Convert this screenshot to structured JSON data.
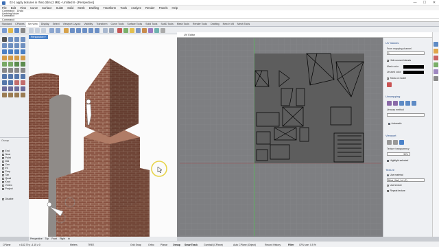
{
  "window": {
    "title": "02-1 apply textures in rhino.3dm (2 MB) - Untitled 8 - [Perspective]",
    "controls": [
      "—",
      "☐",
      "✕"
    ]
  },
  "menu": [
    "File",
    "Edit",
    "View",
    "Curve",
    "Surface",
    "SubD",
    "Solid",
    "Mesh",
    "Drafting",
    "Transform",
    "Tools",
    "Analyze",
    "Render",
    "Panels",
    "Help"
  ],
  "command_history": [
    "Command: _Undo",
    "Undoing Move",
    "Command:"
  ],
  "command_prompt": "Command:",
  "toolbar_tabs": [
    "Standard",
    "CPlanes",
    "Set View",
    "Display",
    "Select",
    "Viewport Layout",
    "Visibility",
    "Transform",
    "Curve Tools",
    "Surface Tools",
    "Solid Tools",
    "SubD Tools",
    "Mesh Tools",
    "Render Tools",
    "Drafting",
    "New in V8",
    "Mesh Tools"
  ],
  "active_tab_index": 2,
  "viewport": {
    "label": "Perspective ▾"
  },
  "viewport_tabs": [
    "Perspective",
    "Top",
    "Front",
    "Right",
    "⊕"
  ],
  "osnap": {
    "header": "Osnap",
    "items": [
      "End",
      "Near",
      "Point",
      "Mid",
      "Cen",
      "Int",
      "Perp",
      "Tan",
      "Quad",
      "Knot",
      "Vertex",
      "Project",
      "Disable"
    ]
  },
  "uv_editor": {
    "title": "UV Editor"
  },
  "panel": {
    "uv_islands": "UV Islands",
    "from_mapping_label": "From mapping channel",
    "mapping_channel": "1",
    "hide_unused": "Hide unused islands",
    "mesh_color_label": "Mesh color",
    "unused_color_label": "Unused color",
    "show_on_model": "Show on model",
    "unwrapping": "Unwrapping",
    "unwrap_method_label": "Unwrap method",
    "automatic": "Automatic",
    "viewport": "Viewport",
    "texture_transparency_label": "Texture transparency",
    "transparency_value": "50%",
    "highlight_selected": "Highlight selected",
    "texture": "Texture",
    "use_material": "Use material",
    "material_name": "Brick_Wall_1x1 (2)",
    "use_texture": "Use texture",
    "repeat_texture": "Repeat texture"
  },
  "status": {
    "cplane": "CPlane",
    "coords": "x 182.79  y -4.15  z 0",
    "units": "Meters",
    "layer": "TREE",
    "grid_snap": "Grid Snap",
    "ortho": "Ortho",
    "planar": "Planar",
    "osnap": "Osnap",
    "smarttrack": "SmartTrack",
    "gumball": "Gumball (CPlane)",
    "autocplane": "Auto CPlane (Object)",
    "record_history": "Record History",
    "filter": "Filter",
    "cpu": "CPU use: 0.5 %"
  },
  "colors": {
    "accent": "#4a82c9",
    "brick": "#8a5443",
    "uv_bg": "#7e7f82",
    "uv_tile": "#5e5e5e"
  }
}
